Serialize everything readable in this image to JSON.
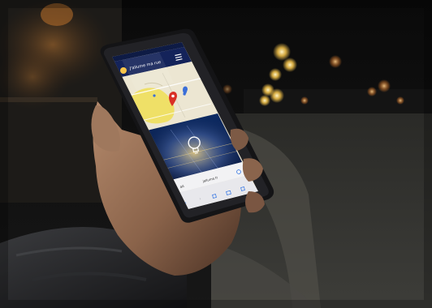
{
  "photo": {
    "subject": "hand-holding-smartphone-at-night",
    "background": "night-street-with-bokeh-lights"
  },
  "phone": {
    "status_bar": {
      "time": ""
    },
    "app_header": {
      "title": "J'allume ma rue",
      "menu_icon": "hamburger-menu-icon"
    },
    "map": {
      "marker_icon": "map-pin-icon"
    },
    "banner": {
      "icon": "lightbulb-icon"
    },
    "browser": {
      "url": "jallume.fr",
      "aa_label": "aA",
      "reload_icon": "reload-icon"
    },
    "toolbar": {
      "icons": [
        "back-icon",
        "forward-icon",
        "share-icon",
        "bookmarks-icon",
        "tabs-icon"
      ]
    }
  },
  "colors": {
    "app_header": "#14235a",
    "map_land": "#e9e3cf",
    "map_region": "#efe067",
    "marker": "#d93025",
    "banner": "#0b1f4a",
    "browser_bar": "#f2f2f4"
  }
}
